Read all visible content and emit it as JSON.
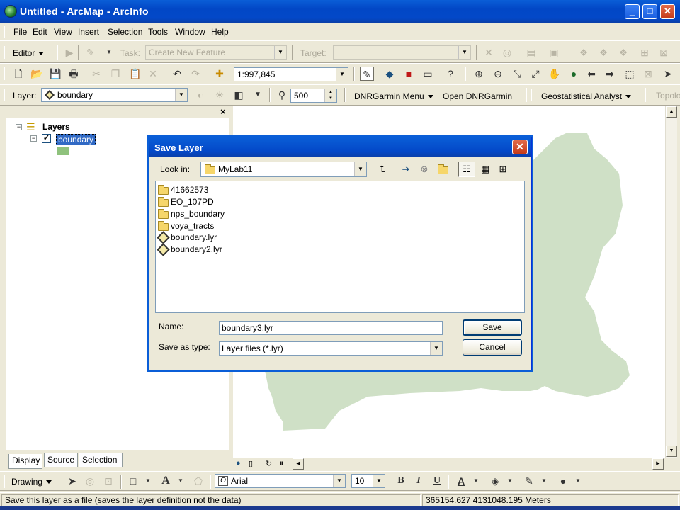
{
  "window": {
    "title": "Untitled - ArcMap - ArcInfo",
    "buttons": {
      "minimize": "_",
      "maximize": "□",
      "close": "✕"
    }
  },
  "menubar": [
    "File",
    "Edit",
    "View",
    "Insert",
    "Selection",
    "Tools",
    "Window",
    "Help"
  ],
  "editor_toolbar": {
    "editor_label": "Editor",
    "task_label": "Task:",
    "task_value": "Create New Feature",
    "target_label": "Target:",
    "target_value": ""
  },
  "standard_toolbar": {
    "scale": "1:997,845"
  },
  "layer_toolbar": {
    "layer_label": "Layer:",
    "layer_value": "boundary",
    "spin_value": "500",
    "dnrgarmin_menu": "DNRGarmin Menu",
    "open_dnrgarmin": "Open DNRGarmin",
    "geostatistical": "Geostatistical Analyst",
    "topology": "Topolo"
  },
  "toc": {
    "root": "Layers",
    "layer": "boundary",
    "layer_checked": true,
    "tabs": [
      "Display",
      "Source",
      "Selection"
    ],
    "active_tab": "Display"
  },
  "dialog": {
    "title": "Save Layer",
    "look_in_label": "Look in:",
    "look_in_value": "MyLab11",
    "files": [
      {
        "name": "41662573",
        "type": "folder"
      },
      {
        "name": "EO_107PD",
        "type": "folder"
      },
      {
        "name": "nps_boundary",
        "type": "folder"
      },
      {
        "name": "voya_tracts",
        "type": "folder"
      },
      {
        "name": "boundary.lyr",
        "type": "layer"
      },
      {
        "name": "boundary2.lyr",
        "type": "layer"
      }
    ],
    "name_label": "Name:",
    "name_value": "boundary3.lyr",
    "type_label": "Save as type:",
    "type_value": "Layer files (*.lyr)",
    "save_label": "Save",
    "cancel_label": "Cancel"
  },
  "drawing_toolbar": {
    "drawing_label": "Drawing",
    "font": "Arial",
    "font_size": "10",
    "bold": "B",
    "italic": "I",
    "underline": "U"
  },
  "status": {
    "message": "Save this layer as a file (saves the layer definition not the data)",
    "coordinates": "365154.627  4131048.195 Meters"
  },
  "colors": {
    "title_blue": "#0348c8",
    "chrome": "#ece9d8",
    "boundary_fill": "#cfe0c6"
  }
}
